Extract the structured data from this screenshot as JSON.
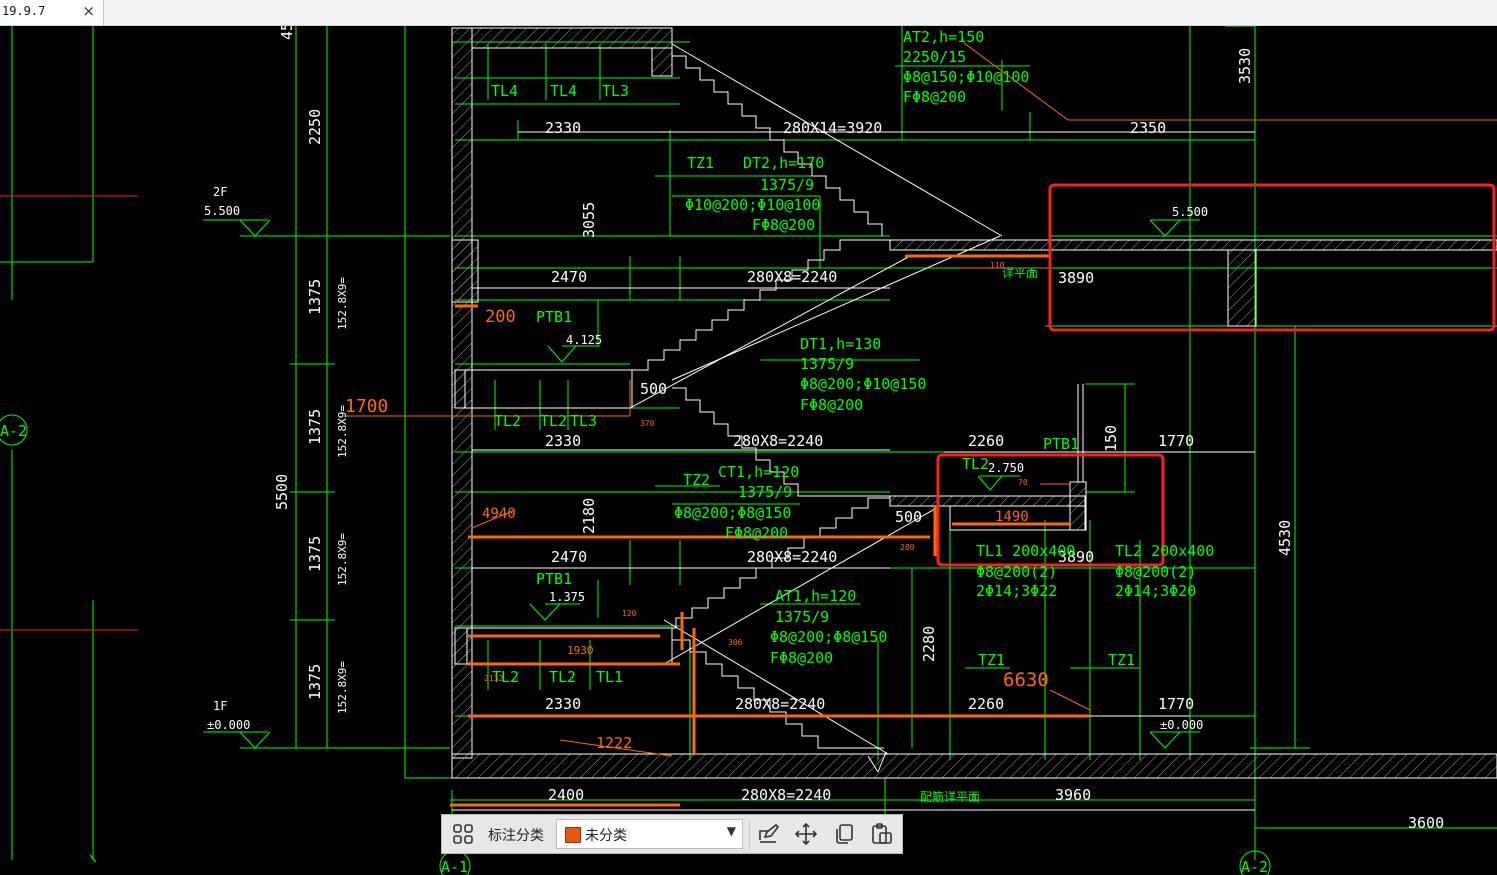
{
  "tab": {
    "title": "19.9.7",
    "close": "×"
  },
  "colors": {
    "green": "#00ff00",
    "white": "#ffffff",
    "orange": "#ff6a00",
    "red": "#ff2020",
    "bg": "#000000",
    "toolbar": "#e7e7e7"
  },
  "levels": {
    "l2f": {
      "name": "2F",
      "elev": "5.500"
    },
    "l1f": {
      "name": "1F",
      "elev": "±0.000"
    },
    "right_top": "5.500",
    "right_bottom": "±0.000",
    "ptb_top": "4.125",
    "ptb_mid": "1.375",
    "tl2_mid": "2.750"
  },
  "axes": {
    "left": "A-2",
    "bottom_left": "A-1",
    "bottom_right": "A-2"
  },
  "dims_vertical": {
    "d45": "45",
    "d2250": "2250",
    "d1375a": "1375",
    "d1375b": "1375",
    "d1375c": "1375",
    "d1375d": "1375",
    "d5500": "5500",
    "d3055": "3055",
    "d2180": "2180",
    "d2280": "2280",
    "d3530": "3530",
    "d4530": "4530",
    "d150": "150",
    "riser_a": "152.8X9=",
    "riser_b": "152.8X9=",
    "riser_c": "152.8X9=",
    "riser_d": "152.8X9="
  },
  "dims_horizontal": {
    "d2330a": "2330",
    "d2330b": "2330",
    "d2330c": "2330",
    "d2470a": "2470",
    "d2470b": "2470",
    "run_top": "280X14=3920",
    "run1": "280X8=2240",
    "run2": "280X8=2240",
    "run3": "280X8=2240",
    "run4": "280X8=2240",
    "run_bottom": "280X8=2240",
    "d2350": "2350",
    "d3890a": "3890",
    "d3890b": "3890",
    "d2260a": "2260",
    "d2260b": "2260",
    "d1770a": "1770",
    "d1770b": "1770",
    "d500a": "500",
    "d500b": "500",
    "d2400": "2400",
    "d3960": "3960",
    "d3600": "3600"
  },
  "beams": {
    "tl4a": "TL4",
    "tl4b": "TL4",
    "tl3a": "TL3",
    "tl3b": "TL3",
    "tl2a": "TL2",
    "tl2b": "TL2",
    "tl2c": "TL2",
    "tl2d": "TL2",
    "tl2e": "TL2",
    "tl1": "TL1",
    "tz1a": "TZ1",
    "tz1b": "TZ1",
    "tz1c": "TZ1",
    "tz2": "TZ2",
    "ptb1a": "PTB1",
    "ptb1b": "PTB1",
    "ptb1c": "PTB1"
  },
  "flights": {
    "at2": {
      "title": "AT2,h=150",
      "span": "2250/15",
      "rebar1": "Φ8@150;Φ10@100",
      "rebar2": "FΦ8@200"
    },
    "dt2": {
      "title": "DT2,h=170",
      "span": "1375/9",
      "rebar1": "Φ10@200;Φ10@100",
      "rebar2": "FΦ8@200"
    },
    "dt1": {
      "title": "DT1,h=130",
      "span": "1375/9",
      "rebar1": "Φ8@200;Φ10@150",
      "rebar2": "FΦ8@200"
    },
    "ct1": {
      "title": "CT1,h=120",
      "span": "1375/9",
      "rebar1": "Φ8@200;Φ8@150",
      "rebar2": "FΦ8@200"
    },
    "at1": {
      "title": "AT1,h=120",
      "span": "1375/9",
      "rebar1": "Φ8@200;Φ8@150",
      "rebar2": "FΦ8@200"
    }
  },
  "beam_details": {
    "tl1": {
      "title": "TL1 200x400",
      "stirrup": "Φ8@200(2)",
      "bars": "2Φ14;3Φ22"
    },
    "tl2": {
      "title": "TL2 200x400",
      "stirrup": "Φ8@200(2)",
      "bars": "2Φ14;3Φ20"
    }
  },
  "notes": {
    "footing": "配筋详平面",
    "top_note": "详平面"
  },
  "annotations": {
    "a200": "200",
    "a1700": "1700",
    "a4940": "4940",
    "a1490": "1490",
    "a6630": "6630",
    "a1930": "1930",
    "a1222": "1222",
    "s370": "370",
    "s120": "120",
    "s306": "306",
    "s280": "280",
    "s2132": "2132",
    "s110": "110",
    "s70": "70"
  },
  "toolbar": {
    "layout_icon": "layout-icon",
    "category_label": "标注分类",
    "category_value": "未分类",
    "category_color": "#e8580c"
  }
}
